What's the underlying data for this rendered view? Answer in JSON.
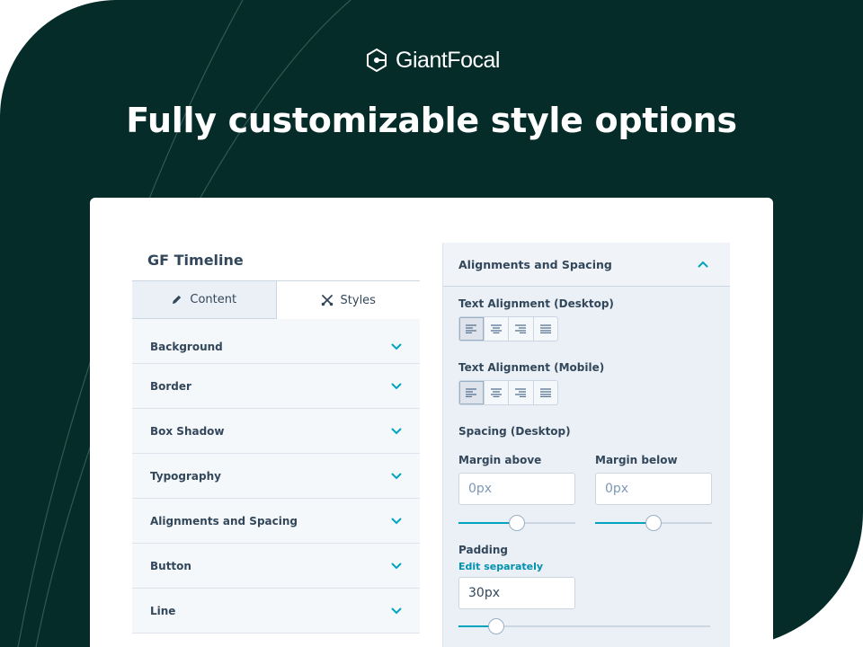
{
  "brand": {
    "name": "GiantFocal"
  },
  "headline": "Fully customizable style options",
  "panel": {
    "title": "GF Timeline",
    "tabs": [
      {
        "label": "Content",
        "icon": "pencil-icon",
        "active": false
      },
      {
        "label": "Styles",
        "icon": "scissors-icon",
        "active": true
      }
    ],
    "sections": [
      {
        "label": "Background"
      },
      {
        "label": "Border"
      },
      {
        "label": "Box Shadow"
      },
      {
        "label": "Typography"
      },
      {
        "label": "Alignments and Spacing"
      },
      {
        "label": "Button"
      },
      {
        "label": "Line"
      }
    ]
  },
  "spacing_panel": {
    "title": "Alignments and Spacing",
    "text_alignment_desktop": {
      "label": "Text Alignment (Desktop)",
      "selected": "left"
    },
    "text_alignment_mobile": {
      "label": "Text Alignment (Mobile)",
      "selected": "left"
    },
    "spacing_desktop_label": "Spacing (Desktop)",
    "margin_above": {
      "label": "Margin above",
      "placeholder": "0px",
      "slider_fraction": 0.5
    },
    "margin_below": {
      "label": "Margin below",
      "placeholder": "0px",
      "slider_fraction": 0.5
    },
    "padding": {
      "label": "Padding",
      "link": "Edit separately",
      "value": "30px",
      "slider_fraction": 0.15
    }
  },
  "colors": {
    "background": "#052c28",
    "accent": "#00a4bd",
    "text": "#33475b"
  }
}
